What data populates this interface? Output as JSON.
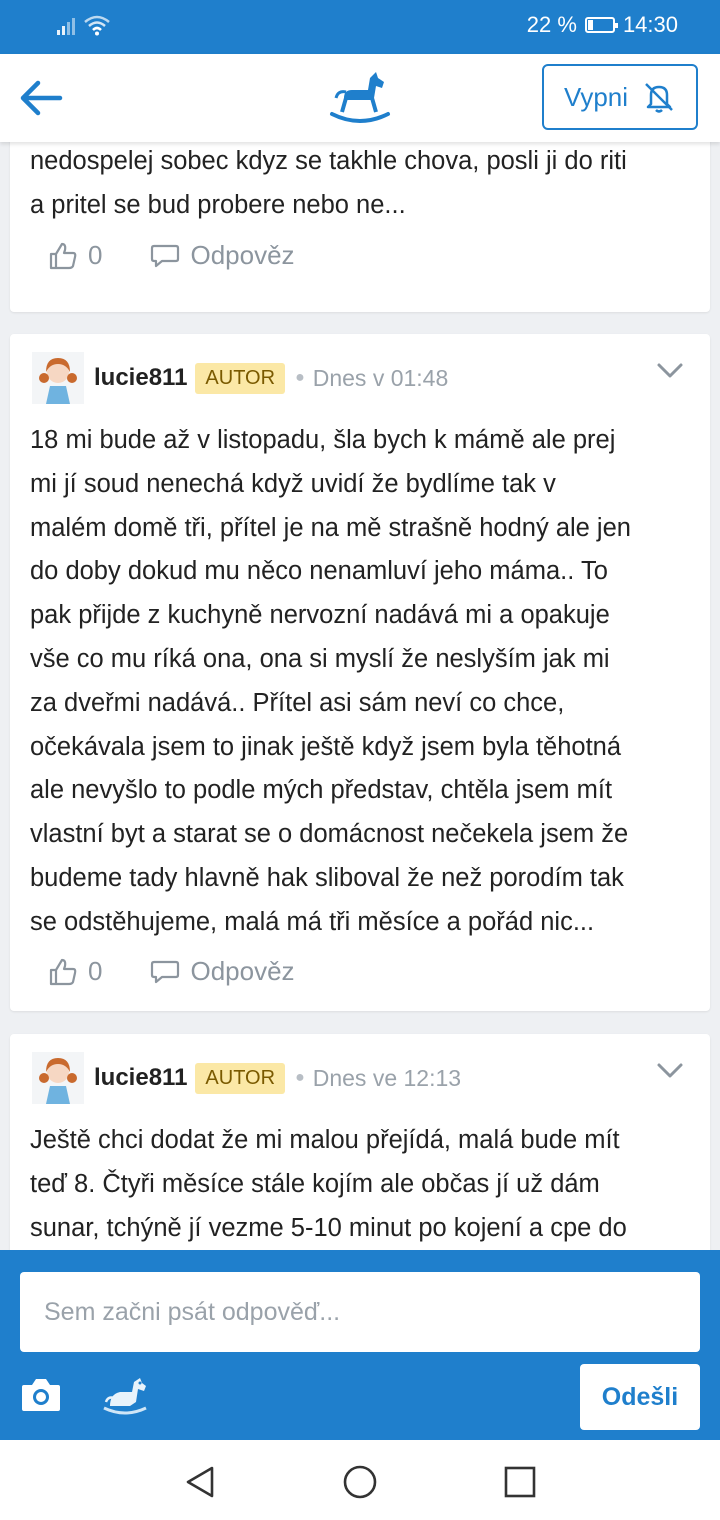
{
  "status_bar": {
    "battery_text": "22 %",
    "battery_level": 0.22,
    "time": "14:30"
  },
  "app_bar": {
    "mute_label": "Vypni"
  },
  "colors": {
    "brand_blue": "#1f7fcc",
    "badge_bg": "#fbe8a6"
  },
  "comments": [
    {
      "text_lines": [
        "nedospelej sobec kdyz se takhle chova, posli ji do riti",
        "a pritel se bud probere nebo ne..."
      ],
      "likes": "0",
      "reply_label": "Odpověz"
    },
    {
      "username": "lucie811",
      "badge": "AUTOR",
      "time": "Dnes v 01:48",
      "text_lines": [
        "18 mi bude až v listopadu, šla bych k mámě ale prej",
        "mi jí soud nenechá když uvidí že bydlíme tak v",
        "malém domě tři, přítel je na mě strašně hodný ale jen",
        "do doby dokud mu něco nenamluví jeho máma.. To",
        "pak přijde z kuchyně nervozní nadává mi a opakuje",
        "vše co mu ríká ona, ona si myslí že neslyším jak mi",
        "za dveřmi nadává.. Přítel asi sám neví co chce,",
        "očekávala jsem to jinak ještě když jsem byla těhotná",
        "ale nevyšlo to podle mých představ, chtěla jsem mít",
        "vlastní byt a starat se o domácnost nečekela jsem že",
        "budeme tady hlavně hak sliboval že než porodím tak",
        "se odstěhujeme, malá má tři měsíce a pořád nic..."
      ],
      "likes": "0",
      "reply_label": "Odpověz"
    },
    {
      "username": "lucie811",
      "badge": "AUTOR",
      "time": "Dnes ve 12:13",
      "text_lines": [
        "Ještě chci dodat že mi malou přejídá, malá bude mít",
        "teď 8. Čtyři měsíce stále kojím ale občas jí už dám",
        "sunar, tchýně jí vezme 5-10 minut po kojení a cpe do"
      ]
    }
  ],
  "composer": {
    "placeholder": "Sem začni psát odpověď...",
    "send_label": "Odešli"
  },
  "icons": {
    "back": "arrow-left-icon",
    "logo": "rocking-horse-logo",
    "mute": "bell-off-icon",
    "like": "thumbs-up-icon",
    "reply": "speech-bubble-icon",
    "expand": "chevron-down-icon",
    "camera": "camera-icon",
    "sticker": "horse-sticker-icon"
  }
}
